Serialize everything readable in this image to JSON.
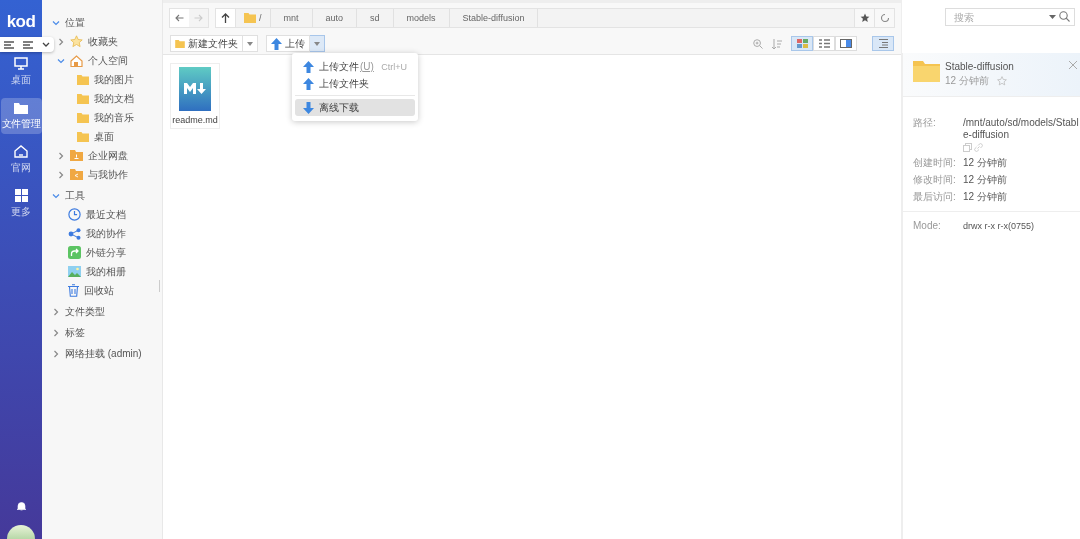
{
  "rail": {
    "logo": "kod",
    "items": [
      {
        "label": "桌面",
        "kind": "monitor",
        "selected": false
      },
      {
        "label": "文件管理",
        "kind": "folder",
        "selected": true
      },
      {
        "label": "官网",
        "kind": "home",
        "selected": false
      },
      {
        "label": "更多",
        "kind": "grid",
        "selected": false
      }
    ]
  },
  "tree": [
    {
      "label": "位置",
      "expanded": true,
      "children": [
        {
          "label": "收藏夹",
          "kind": "star",
          "expanded": false
        },
        {
          "label": "个人空间",
          "kind": "home",
          "expanded": true,
          "children": [
            {
              "label": "我的图片"
            },
            {
              "label": "我的文档"
            },
            {
              "label": "我的音乐"
            },
            {
              "label": "桌面"
            }
          ]
        },
        {
          "label": "企业网盘",
          "kind": "group-folder",
          "expanded": false
        },
        {
          "label": "与我协作",
          "kind": "share-folder",
          "expanded": false
        }
      ]
    },
    {
      "label": "工具",
      "expanded": true,
      "children": [
        {
          "label": "最近文档",
          "kind": "clock"
        },
        {
          "label": "我的协作",
          "kind": "nodes"
        },
        {
          "label": "外链分享",
          "kind": "link-share"
        },
        {
          "label": "我的相册",
          "kind": "image"
        },
        {
          "label": "回收站",
          "kind": "trash"
        }
      ]
    },
    {
      "label": "文件类型",
      "expanded": false
    },
    {
      "label": "标签",
      "expanded": false
    },
    {
      "label": "网络挂载 (admin)",
      "expanded": false
    }
  ],
  "breadcrumb": [
    "/",
    "mnt",
    "auto",
    "sd",
    "models",
    "Stable-diffusion"
  ],
  "search": {
    "placeholder": "搜索"
  },
  "toolbar": {
    "new_folder": "新建文件夹",
    "upload": "上传"
  },
  "upload_menu": [
    {
      "label": "上传文件",
      "accesskey": "(U)",
      "shortcut": "Ctrl+U",
      "kind": "upload",
      "selected": false
    },
    {
      "label": "上传文件夹",
      "kind": "upload",
      "selected": false
    },
    {
      "label": "离线下载",
      "kind": "download",
      "selected": true
    }
  ],
  "view_modes": [
    {
      "kind": "icons",
      "selected": true
    },
    {
      "kind": "list",
      "selected": false
    },
    {
      "kind": "split",
      "selected": false
    }
  ],
  "details_toggle": {
    "selected": true
  },
  "files": [
    {
      "name": "readme.md"
    }
  ],
  "details": {
    "name": "Stable-diffusion",
    "time": "12 分钟前",
    "fields": [
      {
        "label": "路径:",
        "value": "/mnt/auto/sd/models/Stable-diffusion",
        "kind": "path"
      },
      {
        "label": "创建时间:",
        "value": "12 分钟前"
      },
      {
        "label": "修改时间:",
        "value": "12 分钟前"
      },
      {
        "label": "最后访问:",
        "value": "12 分钟前"
      }
    ],
    "mode_label": "Mode:",
    "mode": "drwx r-x r-x(0755)"
  }
}
